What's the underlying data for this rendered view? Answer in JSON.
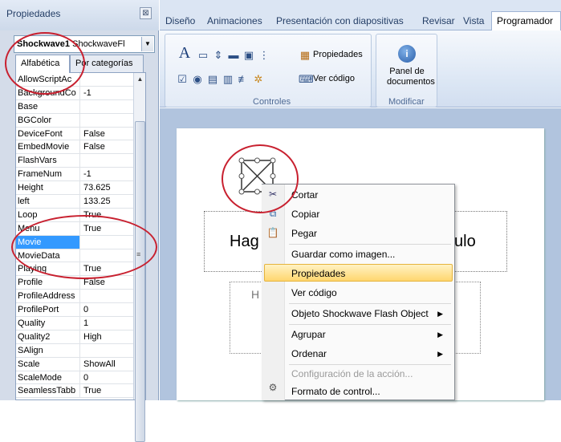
{
  "properties_panel": {
    "title": "Propiedades",
    "close_glyph": "⊠",
    "object_name_bold": "Shockwave1",
    "object_type": "ShockwaveFl",
    "tabs": [
      "Alfabética",
      "Por categorías"
    ],
    "rows": [
      {
        "name": "AllowScriptAc",
        "value": ""
      },
      {
        "name": "BackgroundCo",
        "value": "-1"
      },
      {
        "name": "Base",
        "value": ""
      },
      {
        "name": "BGColor",
        "value": ""
      },
      {
        "name": "DeviceFont",
        "value": "False"
      },
      {
        "name": "EmbedMovie",
        "value": "False"
      },
      {
        "name": "FlashVars",
        "value": ""
      },
      {
        "name": "FrameNum",
        "value": "-1"
      },
      {
        "name": "Height",
        "value": "73.625"
      },
      {
        "name": "left",
        "value": "133.25"
      },
      {
        "name": "Loop",
        "value": "True"
      },
      {
        "name": "Menu",
        "value": "True"
      },
      {
        "name": "Movie",
        "value": ""
      },
      {
        "name": "MovieData",
        "value": ""
      },
      {
        "name": "Playing",
        "value": "True"
      },
      {
        "name": "Profile",
        "value": "False"
      },
      {
        "name": "ProfileAddress",
        "value": ""
      },
      {
        "name": "ProfilePort",
        "value": "0"
      },
      {
        "name": "Quality",
        "value": "1"
      },
      {
        "name": "Quality2",
        "value": "High"
      },
      {
        "name": "SAlign",
        "value": ""
      },
      {
        "name": "Scale",
        "value": "ShowAll"
      },
      {
        "name": "ScaleMode",
        "value": "0"
      },
      {
        "name": "SeamlessTabb",
        "value": "True"
      }
    ],
    "selected_row": "Movie"
  },
  "ribbon": {
    "tabs": [
      "Diseño",
      "Animaciones",
      "Presentación con diapositivas",
      "Revisar",
      "Vista",
      "Programador"
    ],
    "active_tab": "Programador",
    "controls_group_label": "Controles",
    "properties_button": "Propiedades",
    "view_code_button": "Ver código",
    "modify_group_label": "Modificar",
    "doc_panel_line1": "Panel de",
    "doc_panel_line2": "documentos"
  },
  "slide": {
    "title_fragment_left": "Hag",
    "title_fragment_right": "ulo",
    "subtitle_fragment": "H"
  },
  "context_menu": {
    "items": [
      {
        "label": "Cortar",
        "icon": "scissors-icon",
        "enabled": true
      },
      {
        "label": "Copiar",
        "icon": "copy-icon",
        "enabled": true
      },
      {
        "label": "Pegar",
        "icon": "paste-icon",
        "enabled": true
      },
      {
        "label": "Guardar como imagen...",
        "icon": "",
        "enabled": true
      },
      {
        "label": "Propiedades",
        "icon": "",
        "enabled": true,
        "highlighted": true
      },
      {
        "label": "Ver código",
        "icon": "",
        "enabled": true
      },
      {
        "label": "Objeto Shockwave Flash Object",
        "icon": "",
        "enabled": true,
        "submenu": true
      },
      {
        "label": "Agrupar",
        "icon": "",
        "enabled": true,
        "submenu": true
      },
      {
        "label": "Ordenar",
        "icon": "",
        "enabled": true,
        "submenu": true
      },
      {
        "label": "Configuración de la acción...",
        "icon": "",
        "enabled": false
      },
      {
        "label": "Formato de control...",
        "icon": "format-icon",
        "enabled": true
      }
    ]
  },
  "colors": {
    "annotation_ring": "#c8202f",
    "selection": "#3399ff",
    "menu_highlight": "#ffd66f"
  }
}
